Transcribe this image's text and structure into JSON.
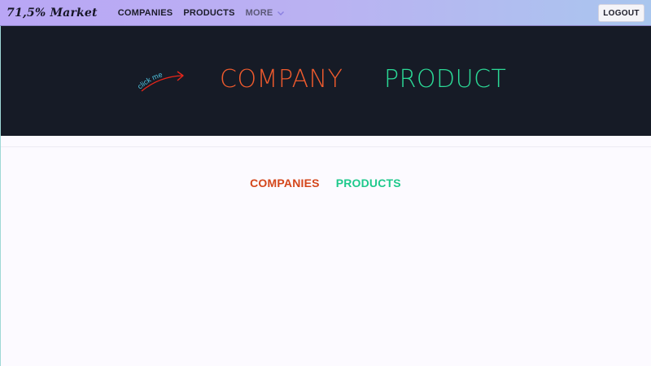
{
  "navbar": {
    "brand": "71,5% Market",
    "links": {
      "companies": "COMPANIES",
      "products": "PRODUCTS",
      "more": "MORE"
    },
    "more_icon": "chevron-down-icon",
    "logout": "LOGOUT"
  },
  "hero": {
    "hint": "click me",
    "hint_icon": "curved-arrow-icon",
    "company": "COMPANY",
    "product": "PRODUCT"
  },
  "tabs": {
    "companies": "COMPANIES",
    "products": "PRODUCTS"
  },
  "colors": {
    "nav_gradient_start": "#b9a6f5",
    "nav_gradient_end": "#a9c6ee",
    "hero_bg": "#161b26",
    "company_accent": "#ee5a2d",
    "product_accent": "#2bd996",
    "hint_text": "#4fc3e0",
    "hint_arrow": "#e8261b"
  }
}
